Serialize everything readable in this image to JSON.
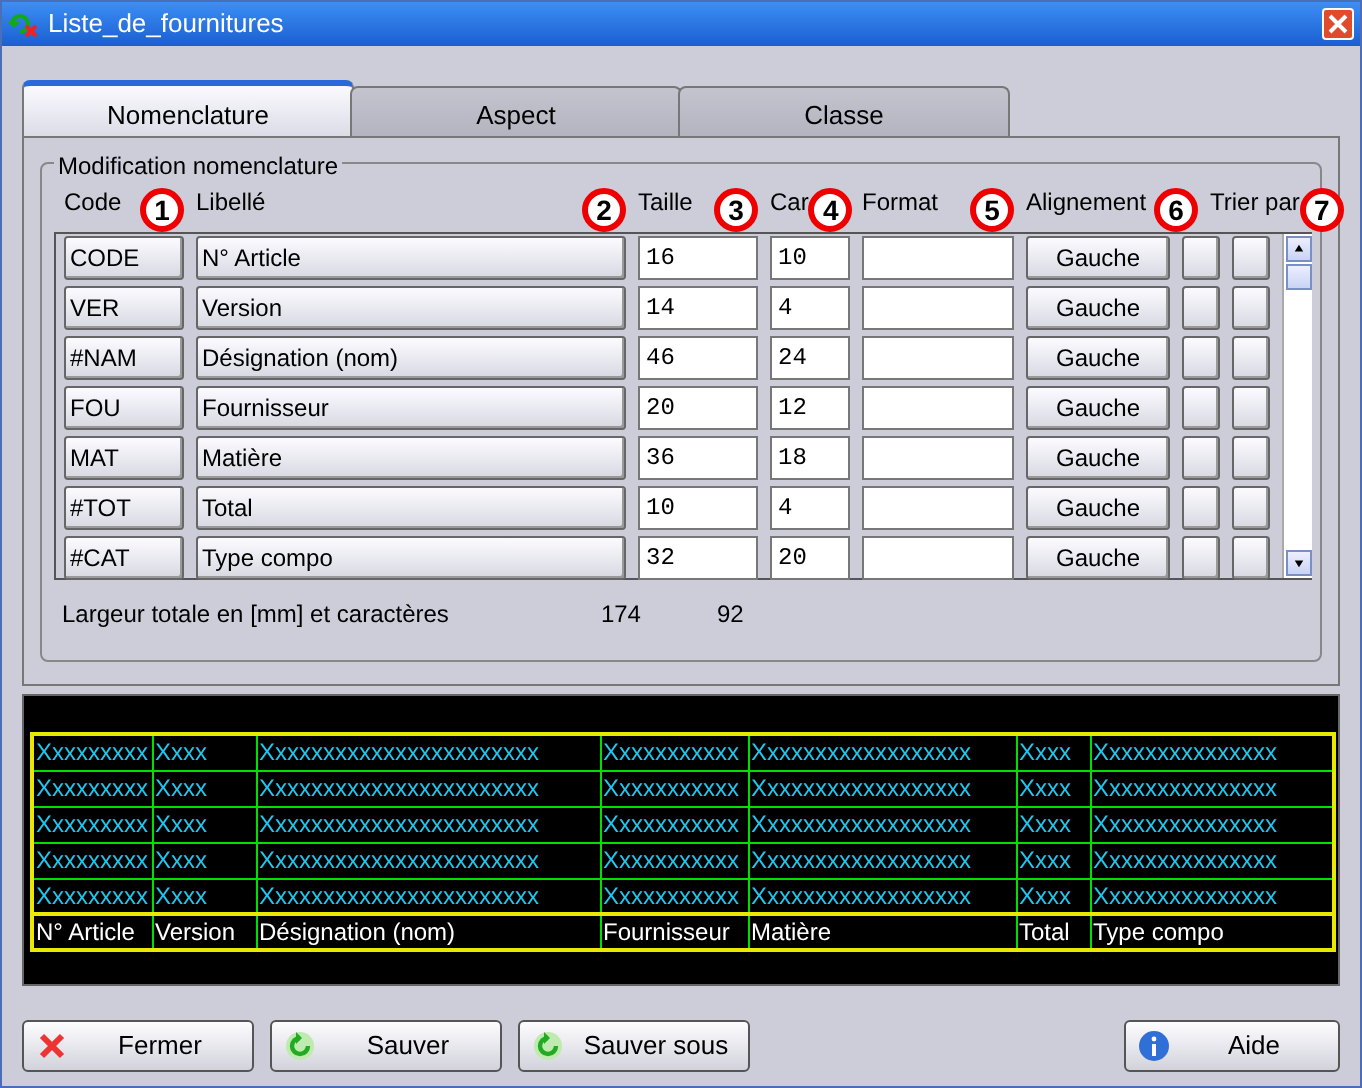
{
  "window": {
    "title": "Liste_de_fournitures"
  },
  "tabs": [
    {
      "label": "Nomenclature",
      "selected": true
    },
    {
      "label": "Aspect",
      "selected": false
    },
    {
      "label": "Classe",
      "selected": false
    }
  ],
  "group": {
    "title": "Modification nomenclature",
    "columns": [
      {
        "label": "Code",
        "marker": "1"
      },
      {
        "label": "Libellé",
        "marker": "2"
      },
      {
        "label": "Taille",
        "marker": "3"
      },
      {
        "label": "Car",
        "marker": "4"
      },
      {
        "label": "Format",
        "marker": "5"
      },
      {
        "label": "Alignement",
        "marker": "6"
      },
      {
        "label": "Trier par",
        "marker": "7"
      }
    ],
    "rows": [
      {
        "code": "CODE",
        "label": "N° Article",
        "size": "16",
        "chars": "10",
        "align": "Gauche",
        "sort": [
          false,
          false
        ]
      },
      {
        "code": "VER",
        "label": "Version",
        "size": "14",
        "chars": "4",
        "align": "Gauche",
        "sort": [
          false,
          false
        ]
      },
      {
        "code": "#NAM",
        "label": "Désignation (nom)",
        "size": "46",
        "chars": "24",
        "align": "Gauche",
        "sort": [
          false,
          false
        ]
      },
      {
        "code": "FOU",
        "label": "Fournisseur",
        "size": "20",
        "chars": "12",
        "align": "Gauche",
        "sort": [
          false,
          false
        ]
      },
      {
        "code": "MAT",
        "label": "Matière",
        "size": "36",
        "chars": "18",
        "align": "Gauche",
        "sort": [
          false,
          false
        ]
      },
      {
        "code": "#TOT",
        "label": "Total",
        "size": "10",
        "chars": "4",
        "align": "Gauche",
        "sort": [
          false,
          false
        ]
      },
      {
        "code": "#CAT",
        "label": "Type compo",
        "size": "32",
        "chars": "20",
        "align": "Gauche",
        "sort": [
          false,
          false
        ]
      }
    ],
    "totals": {
      "label": "Largeur totale en [mm] et caractères",
      "size": "174",
      "chars": "92"
    }
  },
  "preview": {
    "headers": [
      "N° Article",
      "Version",
      "Désignation (nom)",
      "Fournisseur",
      "Matière",
      "Total",
      "Type compo"
    ],
    "rows": [
      [
        "Xxxxxxxxx",
        "Xxxx",
        "Xxxxxxxxxxxxxxxxxxxxxxx",
        "Xxxxxxxxxxx",
        "Xxxxxxxxxxxxxxxxxx",
        "Xxxx",
        "Xxxxxxxxxxxxxxx"
      ],
      [
        "Xxxxxxxxx",
        "Xxxx",
        "Xxxxxxxxxxxxxxxxxxxxxxx",
        "Xxxxxxxxxxx",
        "Xxxxxxxxxxxxxxxxxx",
        "Xxxx",
        "Xxxxxxxxxxxxxxx"
      ],
      [
        "Xxxxxxxxx",
        "Xxxx",
        "Xxxxxxxxxxxxxxxxxxxxxxx",
        "Xxxxxxxxxxx",
        "Xxxxxxxxxxxxxxxxxx",
        "Xxxx",
        "Xxxxxxxxxxxxxxx"
      ],
      [
        "Xxxxxxxxx",
        "Xxxx",
        "Xxxxxxxxxxxxxxxxxxxxxxx",
        "Xxxxxxxxxxx",
        "Xxxxxxxxxxxxxxxxxx",
        "Xxxx",
        "Xxxxxxxxxxxxxxx"
      ],
      [
        "Xxxxxxxxx",
        "Xxxx",
        "Xxxxxxxxxxxxxxxxxxxxxxx",
        "Xxxxxxxxxxx",
        "Xxxxxxxxxxxxxxxxxx",
        "Xxxx",
        "Xxxxxxxxxxxxxxx"
      ]
    ]
  },
  "buttons": [
    {
      "label": "Fermer",
      "kind": "close"
    },
    {
      "label": "Sauver",
      "kind": "save"
    },
    {
      "label": "Sauver sous",
      "kind": "save"
    },
    {
      "label": "Aide",
      "kind": "help"
    }
  ]
}
